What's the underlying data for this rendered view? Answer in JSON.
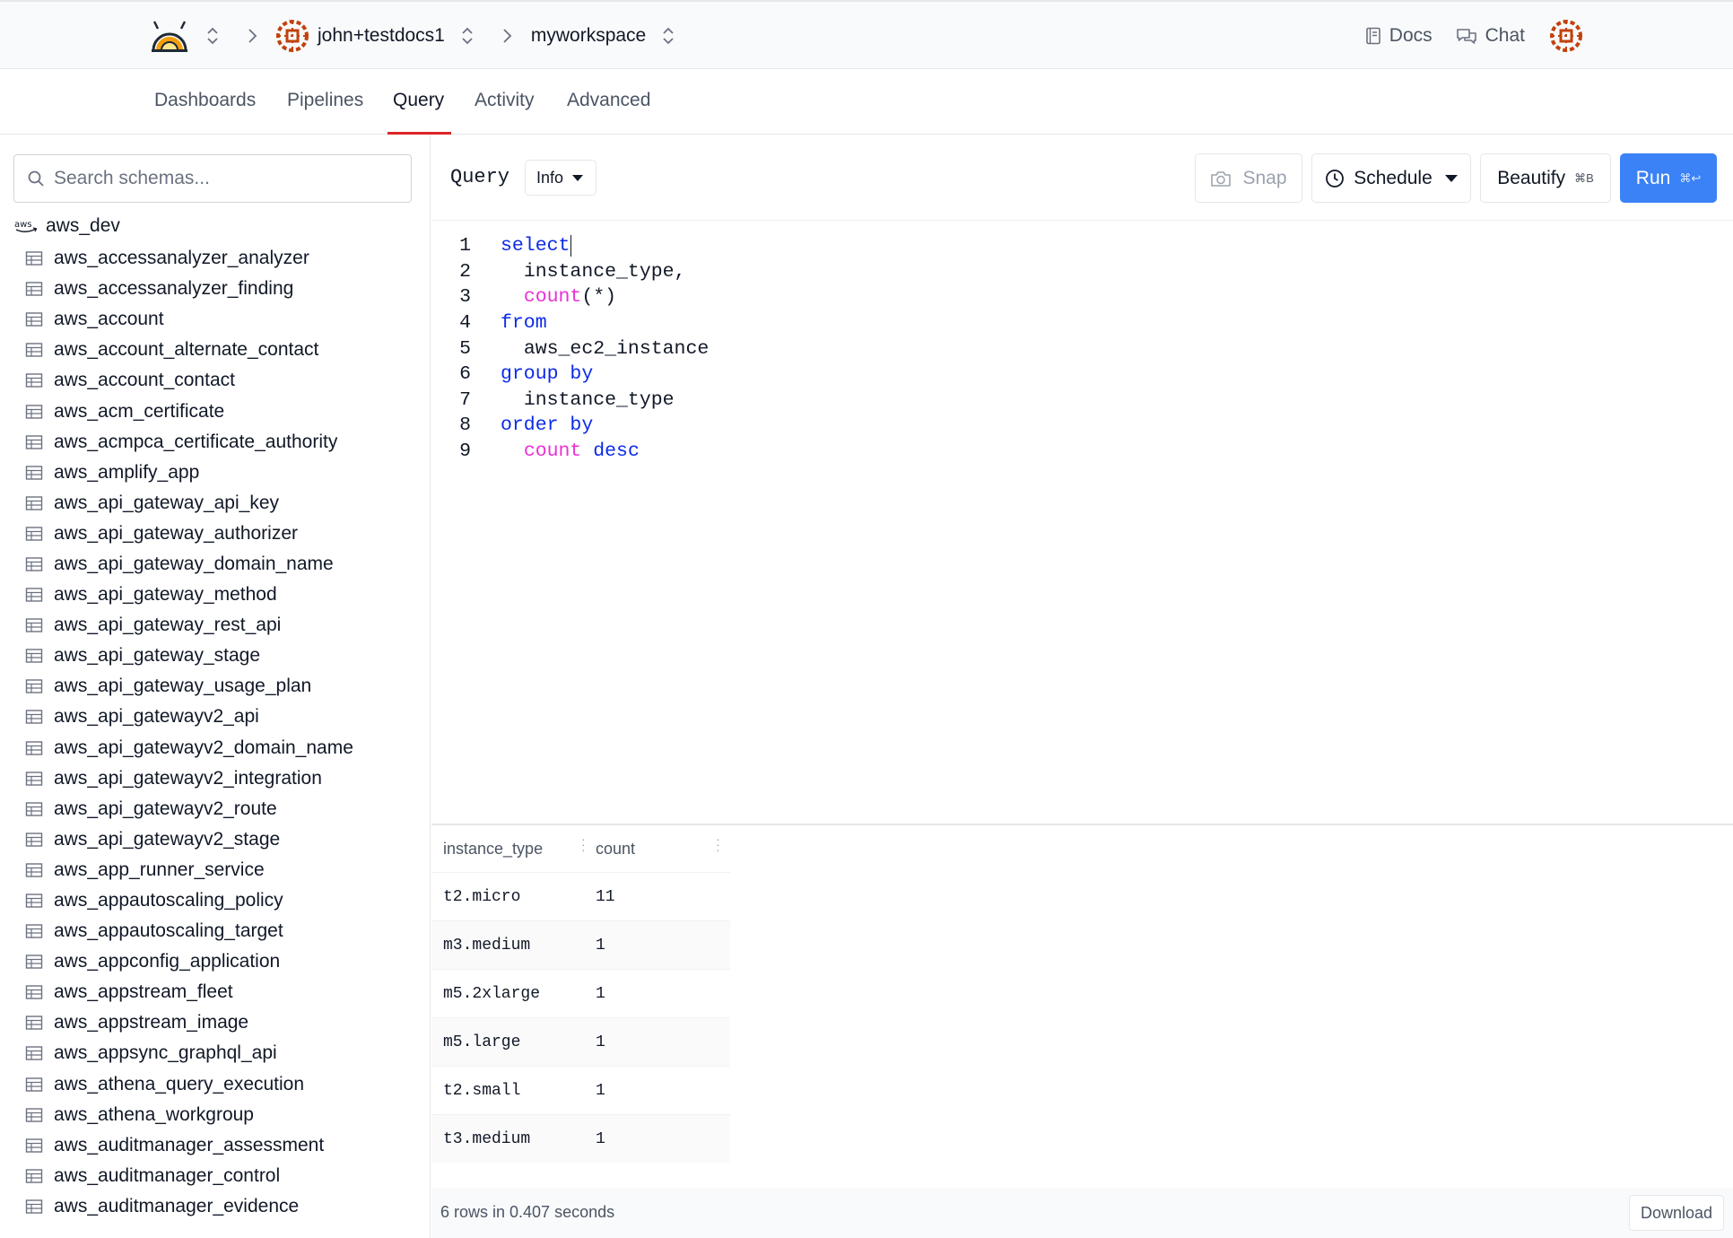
{
  "header": {
    "account": "john+testdocs1",
    "workspace": "myworkspace",
    "docs_label": "Docs",
    "chat_label": "Chat"
  },
  "nav": {
    "tabs": [
      "Dashboards",
      "Pipelines",
      "Query",
      "Activity",
      "Advanced"
    ],
    "active": "Query"
  },
  "sidebar": {
    "search_placeholder": "Search schemas...",
    "schema": "aws_dev",
    "tables": [
      "aws_accessanalyzer_analyzer",
      "aws_accessanalyzer_finding",
      "aws_account",
      "aws_account_alternate_contact",
      "aws_account_contact",
      "aws_acm_certificate",
      "aws_acmpca_certificate_authority",
      "aws_amplify_app",
      "aws_api_gateway_api_key",
      "aws_api_gateway_authorizer",
      "aws_api_gateway_domain_name",
      "aws_api_gateway_method",
      "aws_api_gateway_rest_api",
      "aws_api_gateway_stage",
      "aws_api_gateway_usage_plan",
      "aws_api_gatewayv2_api",
      "aws_api_gatewayv2_domain_name",
      "aws_api_gatewayv2_integration",
      "aws_api_gatewayv2_route",
      "aws_api_gatewayv2_stage",
      "aws_app_runner_service",
      "aws_appautoscaling_policy",
      "aws_appautoscaling_target",
      "aws_appconfig_application",
      "aws_appstream_fleet",
      "aws_appstream_image",
      "aws_appsync_graphql_api",
      "aws_athena_query_execution",
      "aws_athena_workgroup",
      "aws_auditmanager_assessment",
      "aws_auditmanager_control",
      "aws_auditmanager_evidence"
    ]
  },
  "toolbar": {
    "query_label": "Query",
    "info_label": "Info",
    "snap_label": "Snap",
    "schedule_label": "Schedule",
    "beautify_label": "Beautify",
    "beautify_shortcut": "⌘B",
    "run_label": "Run",
    "run_shortcut": "⌘↩"
  },
  "editor": {
    "lines": [
      {
        "n": "1",
        "indent": "",
        "tokens": [
          {
            "t": "select",
            "k": "kw"
          }
        ],
        "cursor": true
      },
      {
        "n": "2",
        "indent": "  ",
        "tokens": [
          {
            "t": "instance_type,",
            "k": "pl"
          }
        ]
      },
      {
        "n": "3",
        "indent": "  ",
        "tokens": [
          {
            "t": "count",
            "k": "fn"
          },
          {
            "t": "(*)",
            "k": "pl"
          }
        ]
      },
      {
        "n": "4",
        "indent": "",
        "tokens": [
          {
            "t": "from",
            "k": "kw"
          }
        ]
      },
      {
        "n": "5",
        "indent": "  ",
        "tokens": [
          {
            "t": "aws_ec2_instance",
            "k": "pl"
          }
        ]
      },
      {
        "n": "6",
        "indent": "",
        "tokens": [
          {
            "t": "group by",
            "k": "kw"
          }
        ]
      },
      {
        "n": "7",
        "indent": "  ",
        "tokens": [
          {
            "t": "instance_type",
            "k": "pl"
          }
        ]
      },
      {
        "n": "8",
        "indent": "",
        "tokens": [
          {
            "t": "order by",
            "k": "kw"
          }
        ]
      },
      {
        "n": "9",
        "indent": "  ",
        "tokens": [
          {
            "t": "count",
            "k": "fn"
          },
          {
            "t": " ",
            "k": "pl"
          },
          {
            "t": "desc",
            "k": "kw"
          }
        ]
      }
    ]
  },
  "results": {
    "columns": [
      "instance_type",
      "count"
    ],
    "rows": [
      [
        "t2.micro",
        "11"
      ],
      [
        "m3.medium",
        "1"
      ],
      [
        "m5.2xlarge",
        "1"
      ],
      [
        "m5.large",
        "1"
      ],
      [
        "t2.small",
        "1"
      ],
      [
        "t3.medium",
        "1"
      ]
    ],
    "status": "6 rows in 0.407 seconds",
    "download_label": "Download"
  },
  "colors": {
    "accent": "#3b82f6",
    "active_tab": "#dc2626",
    "keyword": "#0b2ae8",
    "function": "#e831d4",
    "logo_orange": "#c2410c",
    "logo_yellow": "#f59e0b"
  },
  "icons": [
    "steampipe-logo",
    "updown-icon",
    "chevron-right-icon",
    "org-avatar",
    "docs-icon",
    "chat-icon",
    "search-icon",
    "aws-icon",
    "table-icon",
    "camera-icon",
    "clock-icon"
  ]
}
